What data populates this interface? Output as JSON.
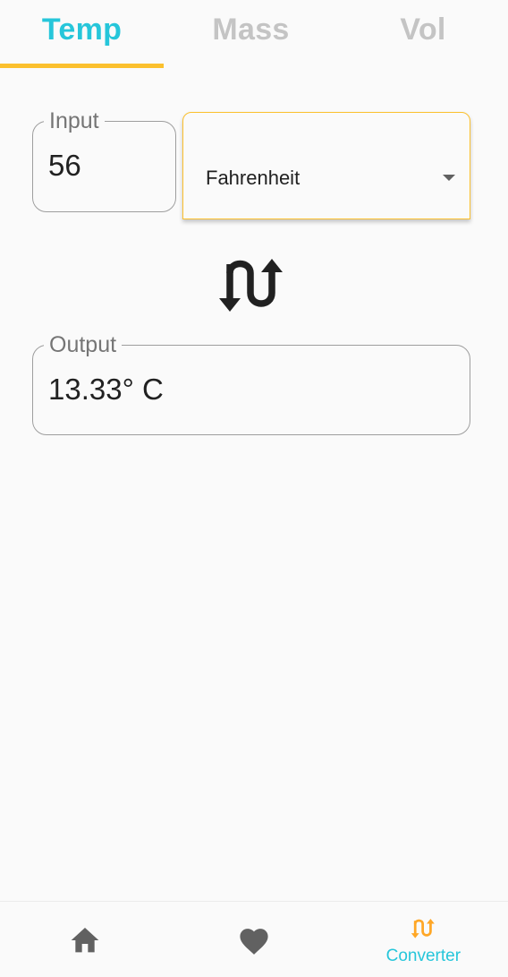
{
  "tabs": [
    {
      "label": "Temp",
      "active": true
    },
    {
      "label": "Mass",
      "active": false
    },
    {
      "label": "Vol",
      "active": false
    }
  ],
  "input": {
    "label": "Input",
    "value": "56"
  },
  "unit_dropdown": {
    "selected": "Fahrenheit"
  },
  "output": {
    "label": "Output",
    "value": "13.33° C"
  },
  "bottom_nav": {
    "items": [
      {
        "icon": "home-icon",
        "label": ""
      },
      {
        "icon": "heart-icon",
        "label": ""
      },
      {
        "icon": "swap-vert-icon",
        "label": "Converter"
      }
    ],
    "selected_index": 2
  },
  "colors": {
    "accent_teal": "#26c6da",
    "accent_amber": "#fbc02d",
    "inactive_gray": "#c4c4c4",
    "nav_icon_active": "#ffa726",
    "nav_icon_inactive": "#616161"
  }
}
